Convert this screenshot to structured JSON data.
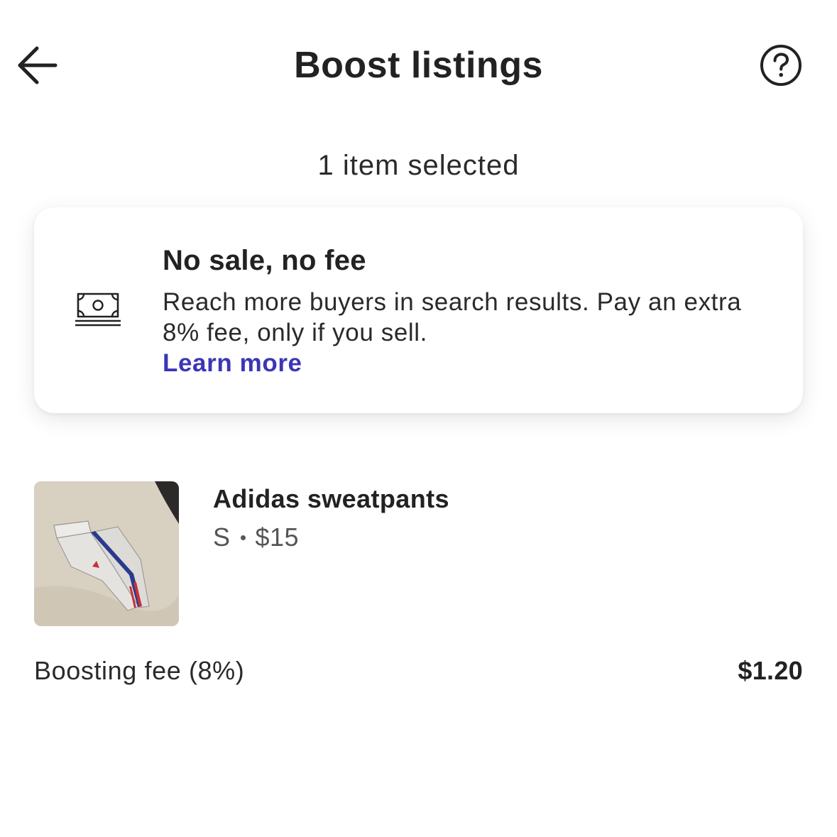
{
  "header": {
    "title": "Boost listings",
    "back_icon": "arrow-left-icon",
    "help_icon": "question-circle-icon"
  },
  "selection": {
    "count_text": "1 item selected"
  },
  "info_card": {
    "icon": "money-bill-icon",
    "title": "No sale, no fee",
    "body": "Reach more buyers in search results. Pay an extra 8% fee, only if you sell.",
    "link_label": "Learn more",
    "link_color": "#3b36b5"
  },
  "item": {
    "name": "Adidas sweatpants",
    "size": "S",
    "price": "$15"
  },
  "fee": {
    "label": "Boosting fee (8%)",
    "value": "$1.20"
  }
}
